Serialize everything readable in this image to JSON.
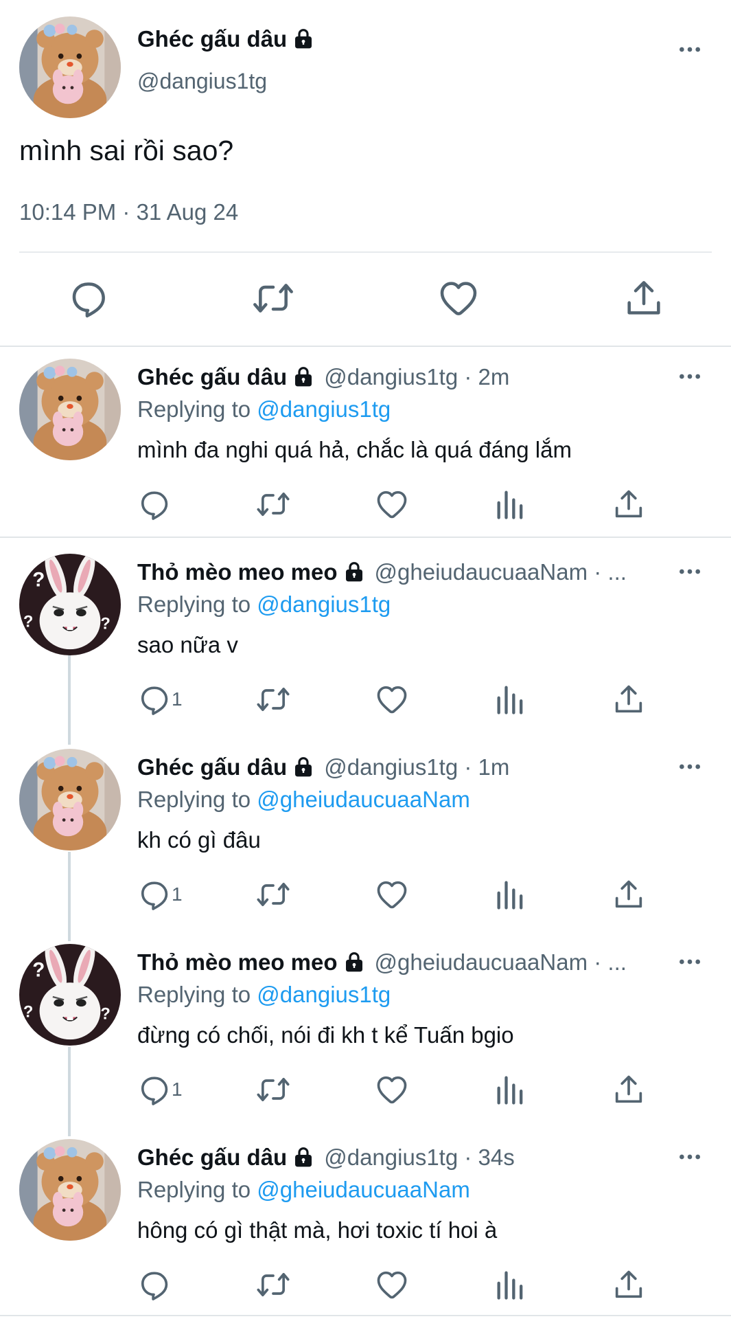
{
  "main_tweet": {
    "author_name": "Ghéc gấu dâu",
    "handle": "@dangius1tg",
    "text": "mình sai rồi sao?",
    "timestamp": "10:14 PM · 31 Aug 24",
    "avatar": "brown-bear-plush-avatar",
    "icons": [
      "reply-icon",
      "retweet-icon",
      "like-icon",
      "share-icon",
      "lock-icon",
      "more-icon"
    ]
  },
  "replies": [
    {
      "author_name": "Ghéc gấu dâu",
      "handle_time": "@dangius1tg · 2m",
      "replying_prefix": "Replying to",
      "replying_to": "@dangius1tg",
      "text": "mình đa nghi quá hả, chắc là quá đáng lắm",
      "reply_count": ""
    },
    {
      "author_name": "Thỏ mèo meo meo",
      "handle_time": "@gheiudaucuaaNam · ...",
      "replying_prefix": "Replying to",
      "replying_to": "@dangius1tg",
      "text": "sao nữa v",
      "reply_count": "1"
    },
    {
      "author_name": "Ghéc gấu dâu",
      "handle_time": "@dangius1tg · 1m",
      "replying_prefix": "Replying to",
      "replying_to": "@gheiudaucuaaNam",
      "text": "kh có gì đâu",
      "reply_count": "1"
    },
    {
      "author_name": "Thỏ mèo meo meo",
      "handle_time": "@gheiudaucuaaNam · ...",
      "replying_prefix": "Replying to",
      "replying_to": "@dangius1tg",
      "text": "đừng có chối, nói đi kh t kể Tuấn bgio",
      "reply_count": "1"
    },
    {
      "author_name": "Ghéc gấu dâu",
      "handle_time": "@dangius1tg · 34s",
      "replying_prefix": "Replying to",
      "replying_to": "@gheiudaucuaaNam",
      "text": "hông có gì thật mà, hơi toxic tí hoi à",
      "reply_count": ""
    }
  ],
  "colors": {
    "link": "#1d9bf0",
    "secondary_text": "#536471",
    "primary_text": "#0f1419",
    "divider": "#e7eaed",
    "thread_line": "#cfd9de"
  }
}
